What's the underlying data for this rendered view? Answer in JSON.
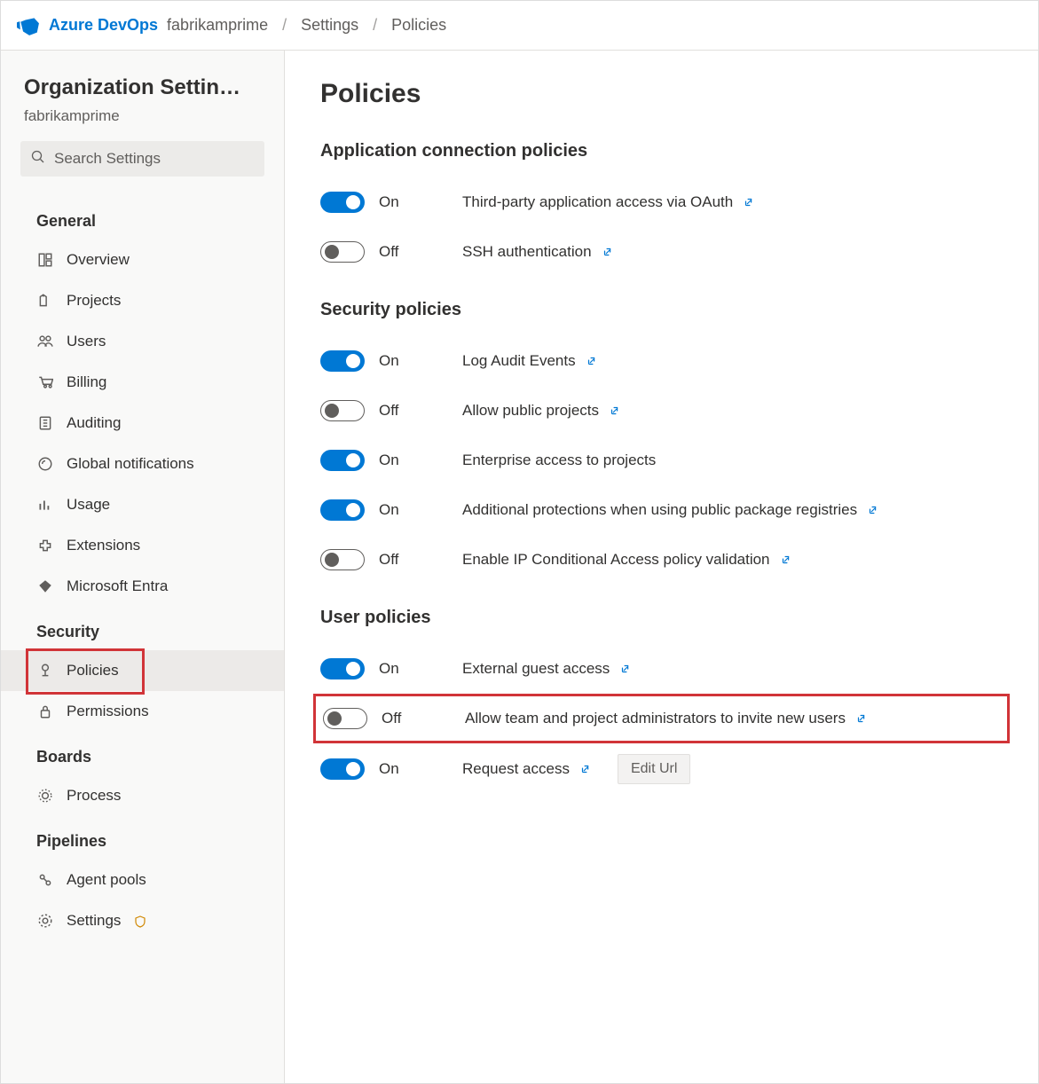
{
  "header": {
    "brand": "Azure DevOps",
    "crumbs": [
      "fabrikamprime",
      "Settings",
      "Policies"
    ]
  },
  "sidebar": {
    "title": "Organization Settin…",
    "subtitle": "fabrikamprime",
    "search_placeholder": "Search Settings",
    "groups": [
      {
        "name": "General",
        "items": [
          {
            "icon": "overview",
            "label": "Overview"
          },
          {
            "icon": "projects",
            "label": "Projects"
          },
          {
            "icon": "users",
            "label": "Users"
          },
          {
            "icon": "billing",
            "label": "Billing"
          },
          {
            "icon": "auditing",
            "label": "Auditing"
          },
          {
            "icon": "notify",
            "label": "Global notifications"
          },
          {
            "icon": "usage",
            "label": "Usage"
          },
          {
            "icon": "extensions",
            "label": "Extensions"
          },
          {
            "icon": "entra",
            "label": "Microsoft Entra"
          }
        ]
      },
      {
        "name": "Security",
        "items": [
          {
            "icon": "policies",
            "label": "Policies",
            "active": true,
            "highlight": true
          },
          {
            "icon": "permissions",
            "label": "Permissions"
          }
        ]
      },
      {
        "name": "Boards",
        "items": [
          {
            "icon": "process",
            "label": "Process"
          }
        ]
      },
      {
        "name": "Pipelines",
        "items": [
          {
            "icon": "agent",
            "label": "Agent pools"
          },
          {
            "icon": "settings",
            "label": "Settings",
            "shield": true
          }
        ]
      }
    ]
  },
  "page": {
    "title": "Policies",
    "sections": [
      {
        "title": "Application connection policies",
        "rows": [
          {
            "state": "on",
            "state_label": "On",
            "label": "Third-party application access via OAuth",
            "link": true
          },
          {
            "state": "off",
            "state_label": "Off",
            "label": "SSH authentication",
            "link": true
          }
        ]
      },
      {
        "title": "Security policies",
        "rows": [
          {
            "state": "on",
            "state_label": "On",
            "label": "Log Audit Events",
            "link": true
          },
          {
            "state": "off",
            "state_label": "Off",
            "label": "Allow public projects",
            "link": true
          },
          {
            "state": "on",
            "state_label": "On",
            "label": "Enterprise access to projects"
          },
          {
            "state": "on",
            "state_label": "On",
            "label": "Additional protections when using public package registries",
            "link": true
          },
          {
            "state": "off",
            "state_label": "Off",
            "label": "Enable IP Conditional Access policy validation",
            "link": true
          }
        ]
      },
      {
        "title": "User policies",
        "rows": [
          {
            "state": "on",
            "state_label": "On",
            "label": "External guest access",
            "link": true
          },
          {
            "state": "off",
            "state_label": "Off",
            "label": "Allow team and project administrators to invite new users",
            "link": true,
            "highlight": true
          },
          {
            "state": "on",
            "state_label": "On",
            "label": "Request access",
            "link": true,
            "edit_url": "Edit Url"
          }
        ]
      }
    ]
  }
}
